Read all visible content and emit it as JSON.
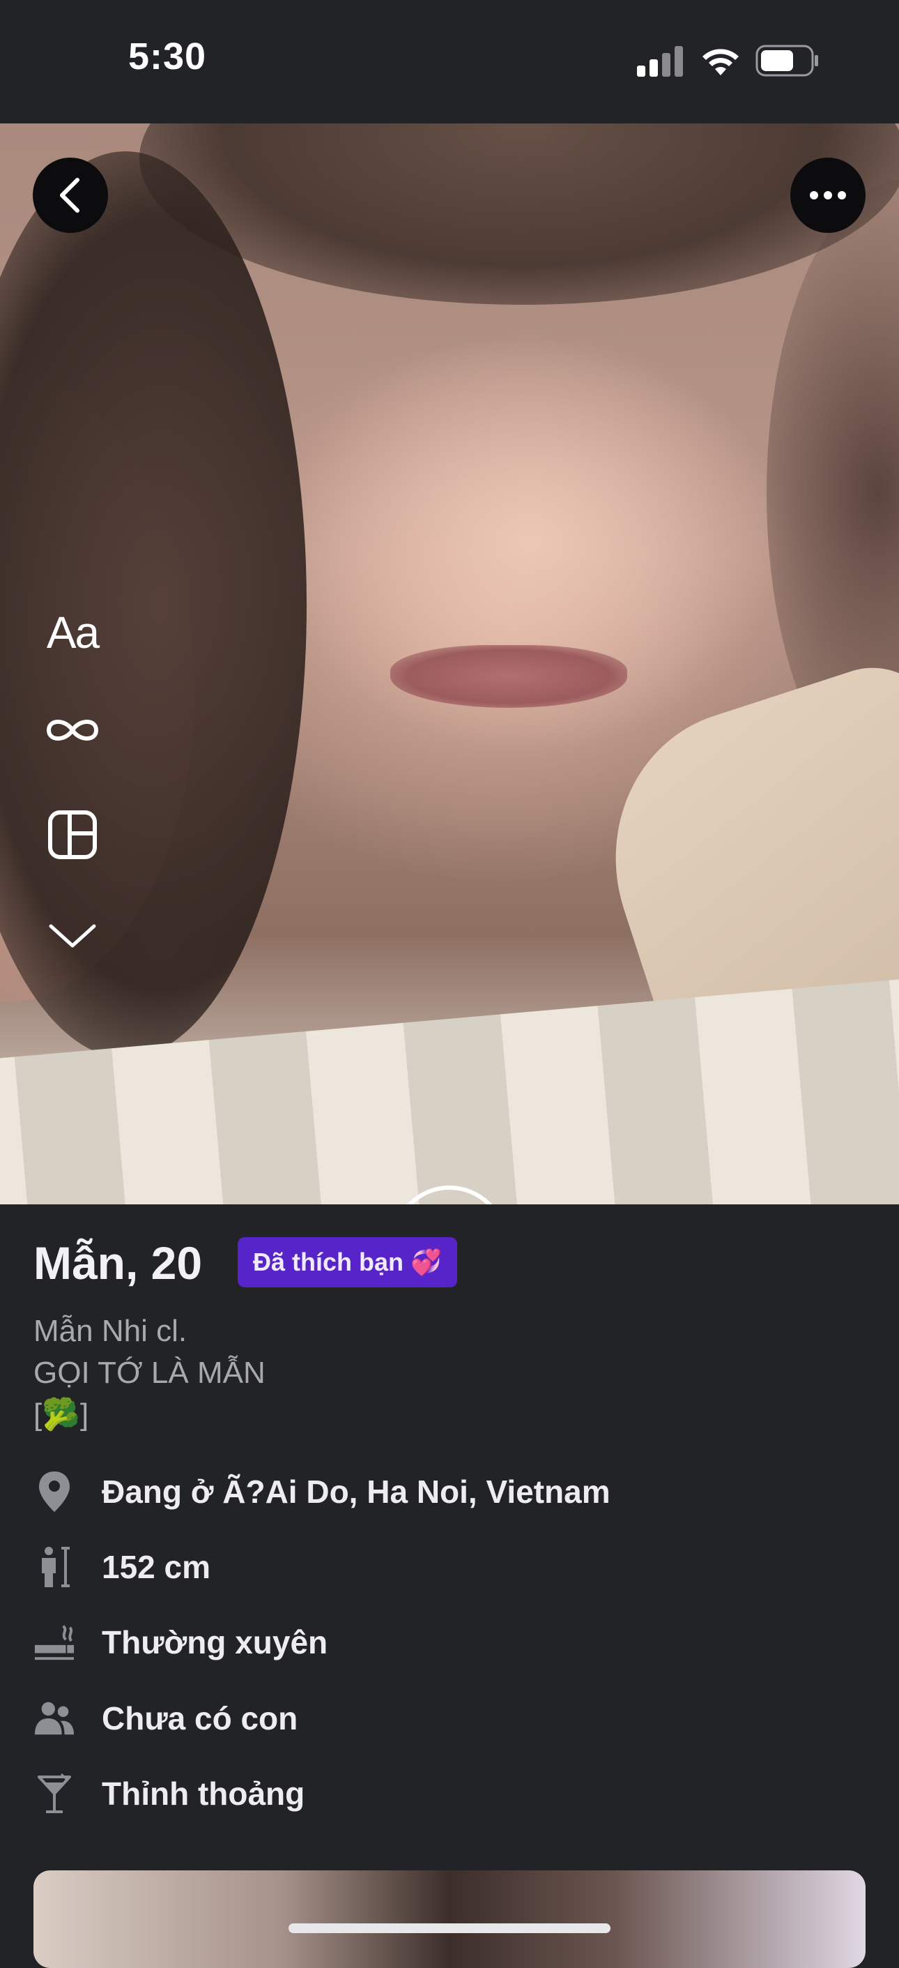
{
  "status_bar": {
    "time": "5:30",
    "icons": [
      "signal-icon",
      "wifi-icon",
      "battery-icon"
    ]
  },
  "photo": {
    "controls": [
      "back-icon",
      "more-icon"
    ],
    "story_tools": {
      "text_tool": "Aa",
      "icons": [
        "boomerang-icon",
        "layout-icon",
        "chevron-down-icon"
      ]
    }
  },
  "profile": {
    "name_age": "Mẫn, 20",
    "liked_badge": {
      "label": "Đã thích bạn",
      "emoji": "💞",
      "color": "#5624c8"
    },
    "bio": {
      "line1": "Mẫn Nhi cl.",
      "line2": "GỌI TỚ LÀ MẪN",
      "line3_open": "[",
      "line3_emoji": "🥦",
      "line3_close": "]"
    },
    "details": [
      {
        "icon": "location-pin-icon",
        "text": "Đang ở Ã?Ai Do, Ha Noi, Vietnam"
      },
      {
        "icon": "height-icon",
        "text": "152 cm"
      },
      {
        "icon": "smoking-icon",
        "text": "Thường xuyên"
      },
      {
        "icon": "children-icon",
        "text": "Chưa có con"
      },
      {
        "icon": "cocktail-icon",
        "text": "Thỉnh thoảng"
      }
    ]
  },
  "colors": {
    "background": "#222327",
    "badge": "#5624c8",
    "text_primary": "#ededef",
    "text_secondary": "#a8a9ad"
  }
}
